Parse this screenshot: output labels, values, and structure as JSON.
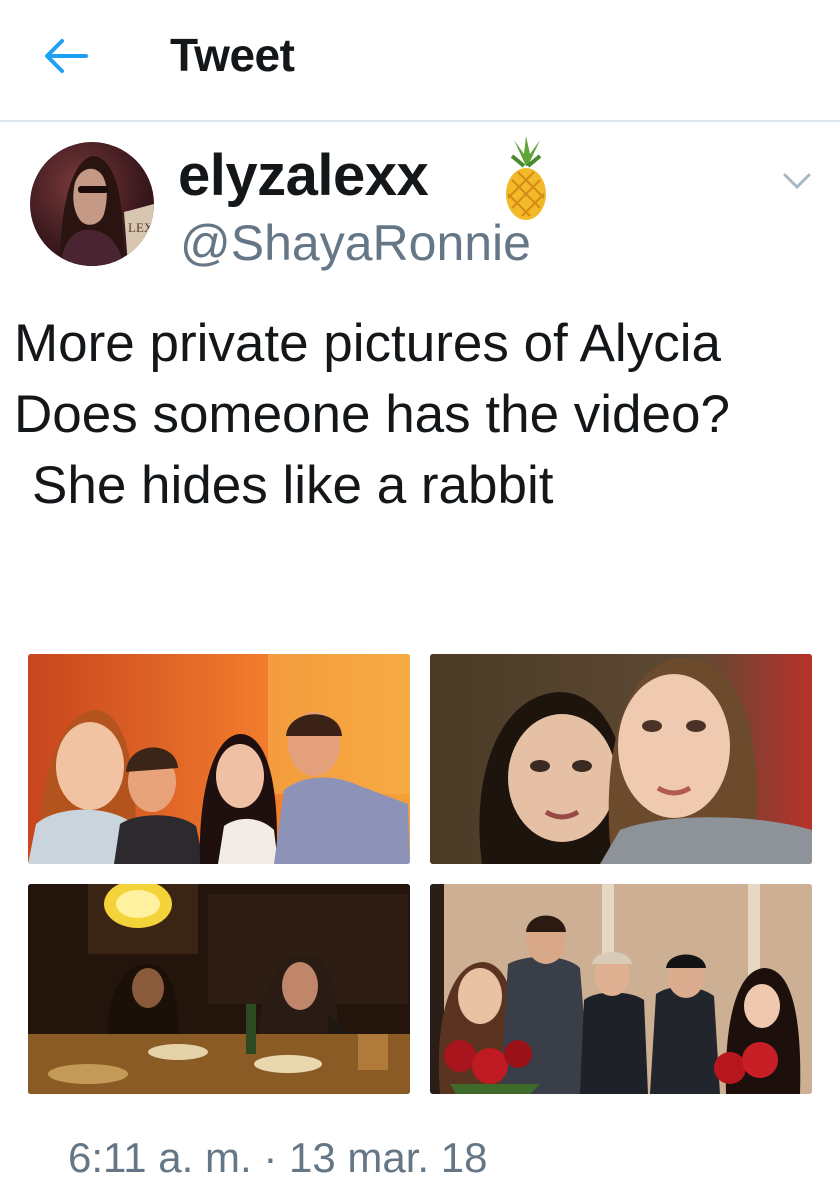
{
  "header": {
    "title": "Tweet",
    "back_icon": "arrow-left-icon",
    "accent_color": "#1da1f2"
  },
  "author": {
    "display_name": "elyzalexx",
    "name_emoji": "pineapple-icon",
    "handle": "@ShayaRonnie",
    "avatar_text": "LEXA DESER"
  },
  "tweet": {
    "lines": [
      "More private pictures of Alycia",
      "Does someone has the video?",
      "She hides like a rabbit"
    ],
    "timestamp": "6:11 a. m. · 13 mar. 18"
  },
  "media": {
    "count": 4
  },
  "colors": {
    "text": "#14171a",
    "secondary": "#657786",
    "divider": "#e1e8ed"
  }
}
